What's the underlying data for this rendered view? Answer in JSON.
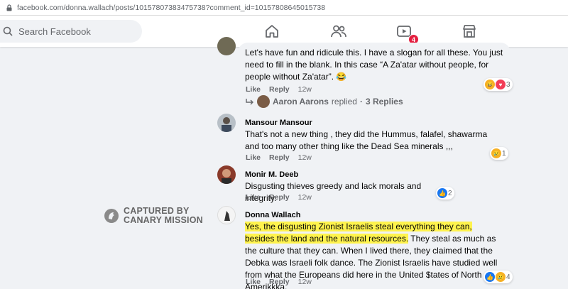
{
  "browser": {
    "url": "facebook.com/donna.wallach/posts/10157807383475738?comment_id=10157808645015738"
  },
  "header": {
    "search_placeholder": "Search Facebook",
    "nav": [
      {
        "name": "home-icon"
      },
      {
        "name": "friends-icon"
      },
      {
        "name": "watch-icon",
        "badge": "4"
      },
      {
        "name": "marketplace-icon"
      }
    ],
    "badge_color": "#e41e3f"
  },
  "comments": [
    {
      "text": "Let's have fun and ridicule this. I have a slogan for all these. You just need to fill in the blank. In this case “A Za'atar without people, for people without Za'atar”.",
      "like": "Like",
      "reply": "Reply",
      "time": "12w",
      "reactions": {
        "icons": [
          "haha-icon",
          "love-icon"
        ],
        "count": "3"
      }
    },
    {
      "replies": {
        "author": "Aaron Aarons",
        "text": "replied",
        "sep": "·",
        "count_text": "3 Replies"
      }
    },
    {
      "author": "Mansour Mansour",
      "text": "That's not a new thing , they did the Hummus, falafel, shawarma and too many other thing like the Dead Sea minerals ,,,",
      "like": "Like",
      "reply": "Reply",
      "time": "12w",
      "reactions": {
        "icons": [
          "sad-icon"
        ],
        "count": "1"
      }
    },
    {
      "author": "Monir M. Deeb",
      "text": "Disgusting thieves greedy and lack morals and integrity.",
      "like": "Like",
      "reply": "Reply",
      "time": "12w",
      "reactions": {
        "icons": [
          "like-icon"
        ],
        "count": "2"
      }
    },
    {
      "author": "Donna Wallach",
      "text_highlight": "Yes, the disgusting Zionist Israelis steal everything they can, besides the land and the natural resources.",
      "text_rest": " They steal as much as the culture that they can. When I lived there, they claimed that the Debka was Israeli folk dance. The Zionist Israelis have studied well from what the Europeans did here in the United $tates of North Amerikkka.",
      "like": "Like",
      "reply": "Reply",
      "time": "12w",
      "reactions": {
        "icons": [
          "like-icon",
          "sad-icon"
        ],
        "count": "4"
      }
    }
  ],
  "watermark": {
    "line1": "CAPTURED BY",
    "line2": "CANARY MISSION"
  },
  "colors": {
    "highlight": "#fff34d",
    "like_blue": "#1877f2",
    "love_red": "#f33e58",
    "haha_yellow": "#f7b125"
  }
}
